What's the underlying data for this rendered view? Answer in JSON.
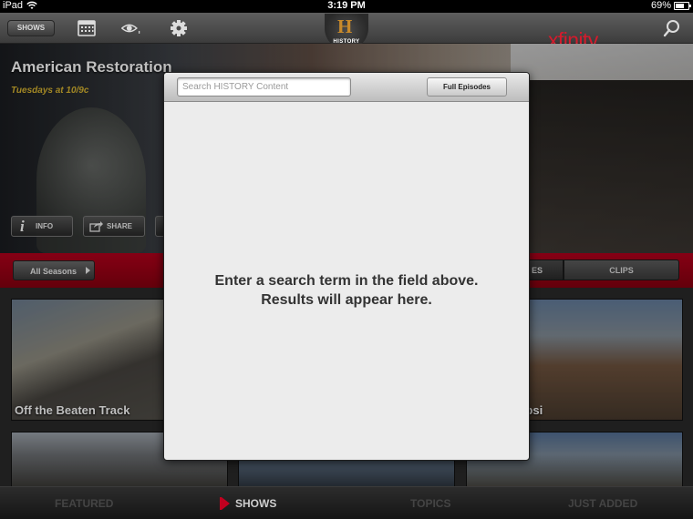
{
  "status_bar": {
    "device": "iPad",
    "time": "3:19 PM",
    "battery": "69%"
  },
  "top_bar": {
    "shows_button": "SHOWS",
    "logo_text": "HISTORY",
    "logo_letter": "H",
    "brand": "xfinity"
  },
  "hero": {
    "title": "American Restoration",
    "schedule": "Tuesdays at 10/9c",
    "info_label": "INFO",
    "info_glyph": "i",
    "share_label": "SHARE"
  },
  "filter_bar": {
    "seasons_label": "All Seasons",
    "segment_partial": "ES",
    "segment_clips": "CLIPS"
  },
  "tiles": [
    {
      "caption": "Off the Beaten Track"
    },
    {
      "caption": "ite and Pepsi"
    }
  ],
  "tab_bar": {
    "tabs": [
      "FEATURED",
      "SHOWS",
      "TOPICS",
      "JUST ADDED"
    ],
    "selected": "SHOWS"
  },
  "search_modal": {
    "placeholder": "Search HISTORY Content",
    "value": "",
    "full_episodes_label": "Full Episodes",
    "empty_line1": "Enter a search term in the field above.",
    "empty_line2": "Results will appear here."
  },
  "colors": {
    "accent_red": "#b3001c",
    "brand_red": "#d41b2c",
    "schedule_gold": "#d8b531"
  }
}
